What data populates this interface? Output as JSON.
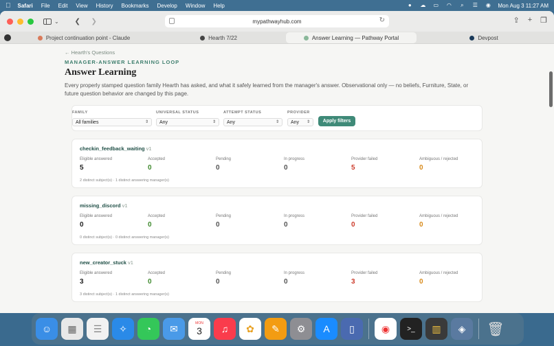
{
  "menubar": {
    "app": "Safari",
    "items": [
      "File",
      "Edit",
      "View",
      "History",
      "Bookmarks",
      "Develop",
      "Window",
      "Help"
    ],
    "clock": "Mon Aug 3  11:27 AM"
  },
  "browser": {
    "url": "mypathwayhub.com",
    "tabs": [
      {
        "label": "Project continuation point - Claude",
        "color": "#d97a5a"
      },
      {
        "label": "Hearth 7/22",
        "color": "#444444"
      },
      {
        "label": "Answer Learning — Pathway Portal",
        "color": "#8ab89a"
      },
      {
        "label": "Devpost",
        "color": "#1a3a5a"
      }
    ]
  },
  "page": {
    "back": "← Hearth's Questions",
    "kicker": "MANAGER-ANSWER LEARNING LOOP",
    "title": "Answer Learning",
    "description": "Every properly stamped question family Hearth has asked, and what it safely learned from the manager's answer. Observational only — no beliefs, Furniture, State, or future question behavior are changed by this page."
  },
  "filters": {
    "family_label": "FAMILY",
    "family_value": "All families",
    "universal_label": "UNIVERSAL STATUS",
    "universal_value": "Any",
    "attempt_label": "ATTEMPT STATUS",
    "attempt_value": "Any",
    "provider_label": "PROVIDER",
    "provider_value": "Any",
    "apply": "Apply filters"
  },
  "stat_labels": {
    "eligible": "Eligible answered",
    "accepted": "Accepted",
    "pending": "Pending",
    "in_progress": "In progress",
    "provider_failed": "Provider failed",
    "ambiguous": "Ambiguous / rejected"
  },
  "families": [
    {
      "name": "checkin_feedback_waiting",
      "version": "v1",
      "eligible": "5",
      "accepted": "0",
      "pending": "0",
      "in_progress": "0",
      "provider_failed": "5",
      "ambiguous": "0",
      "footer": "2 distinct subject(s) · 1 distinct answering manager(s)"
    },
    {
      "name": "missing_discord",
      "version": "v1",
      "eligible": "0",
      "accepted": "0",
      "pending": "0",
      "in_progress": "0",
      "provider_failed": "0",
      "ambiguous": "0",
      "footer": "0 distinct subject(s) · 0 distinct answering manager(s)"
    },
    {
      "name": "new_creator_stuck",
      "version": "v1",
      "eligible": "3",
      "accepted": "0",
      "pending": "0",
      "in_progress": "0",
      "provider_failed": "3",
      "ambiguous": "0",
      "footer": "3 distinct subject(s) · 1 distinct answering manager(s)"
    }
  ],
  "dock": {
    "calendar_month": "MON",
    "calendar_day": "3"
  }
}
